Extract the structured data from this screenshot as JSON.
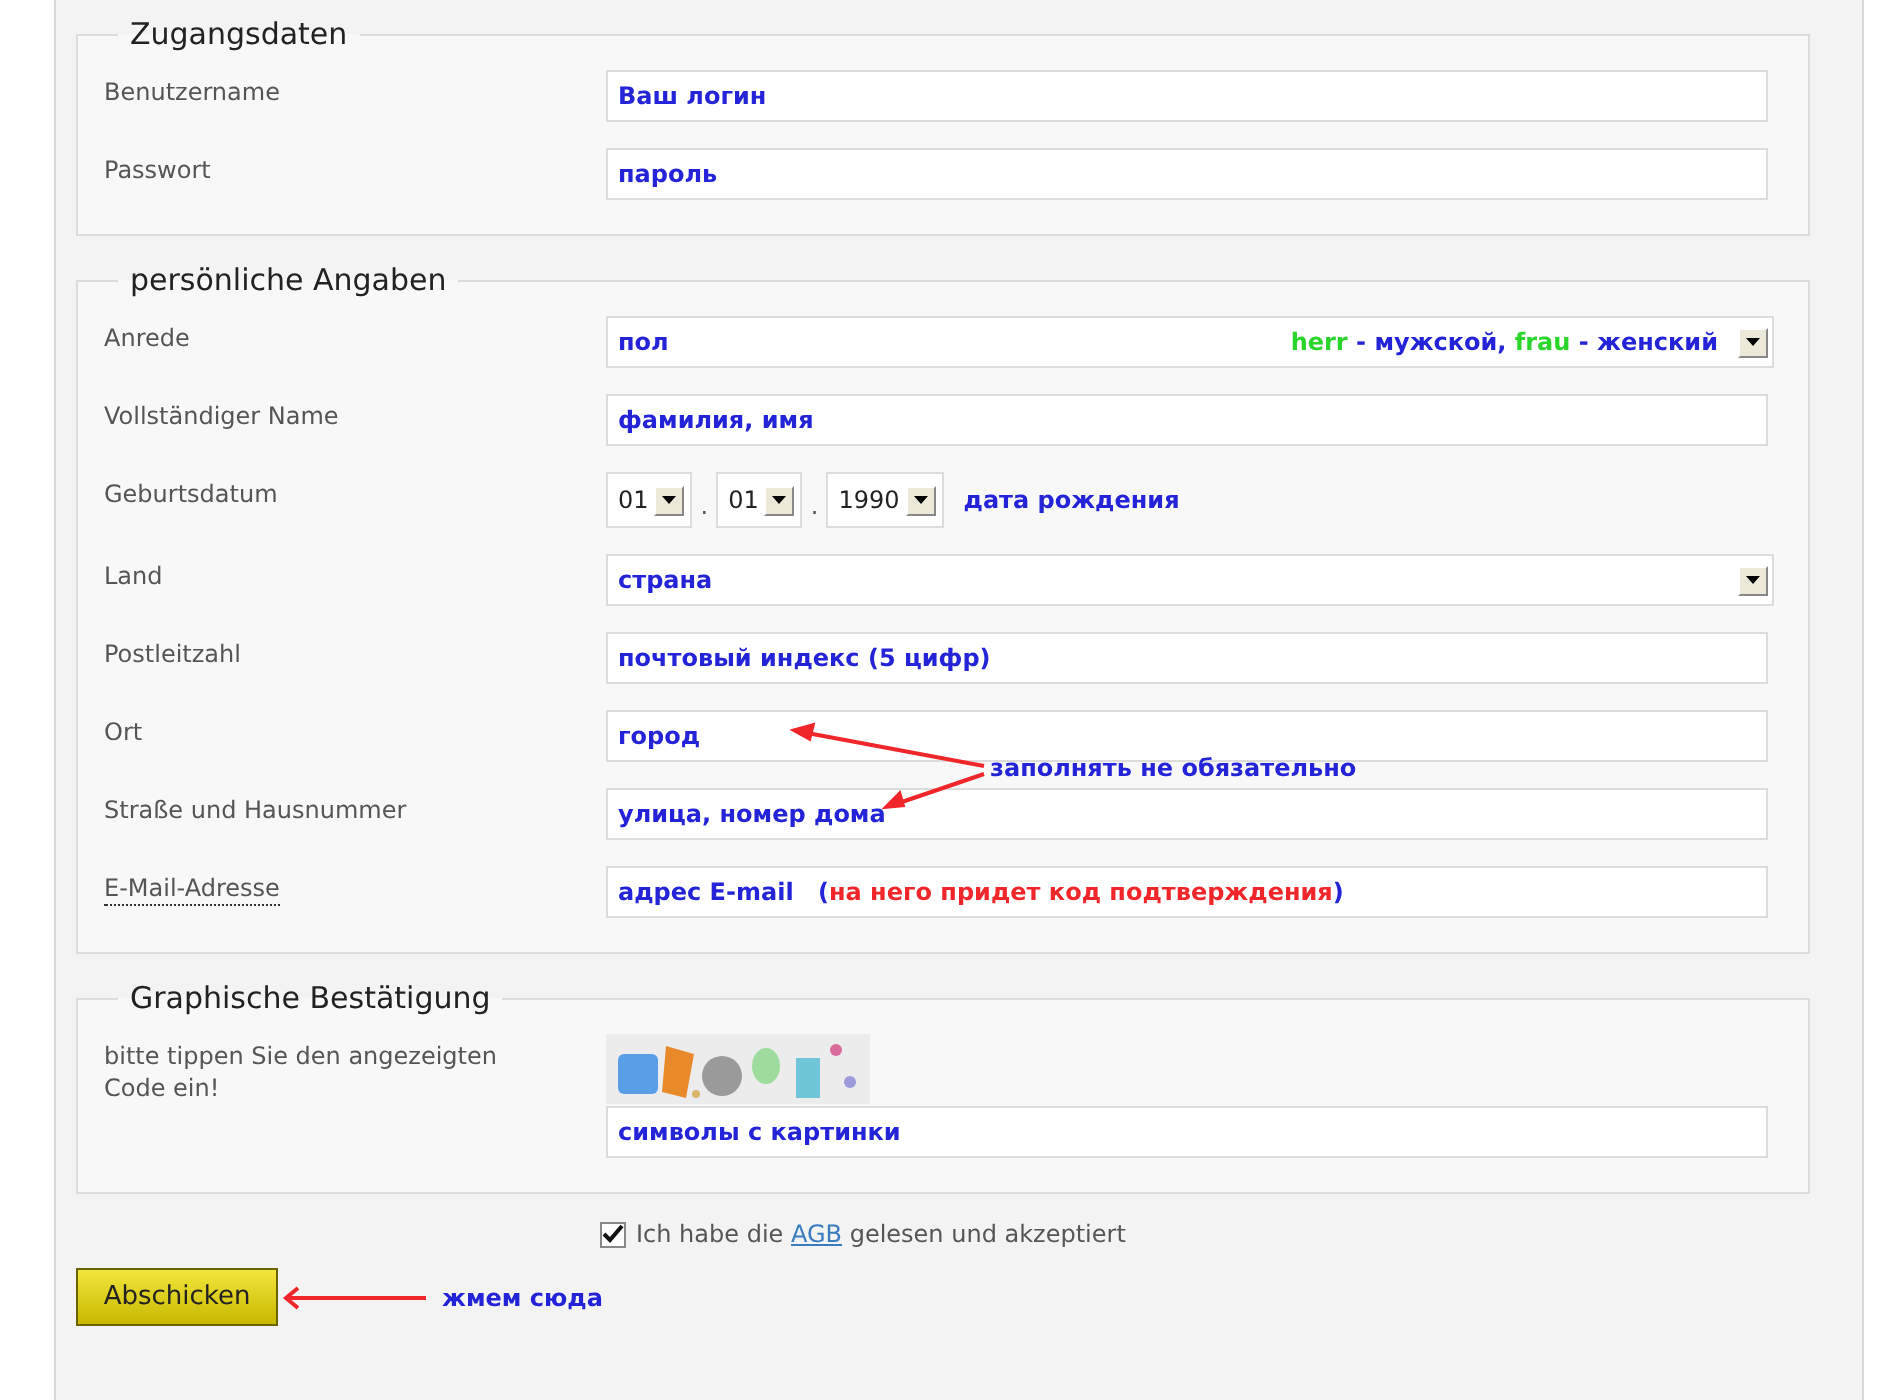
{
  "sections": [
    {
      "legend": "Zugangsdaten",
      "rows": [
        {
          "kind": "text",
          "label": "Benutzername",
          "value": "Ваш логин"
        },
        {
          "kind": "text",
          "label": "Passwort",
          "value": "пароль"
        }
      ]
    },
    {
      "legend": "persönliche Angaben",
      "rows": [
        {
          "kind": "select",
          "label": "Anrede",
          "value": "пол",
          "hint": [
            {
              "kind": "term",
              "text": "herr"
            },
            {
              "kind": "gloss",
              "text": "- мужской,"
            },
            {
              "kind": "term",
              "text": "frau"
            },
            {
              "kind": "gloss",
              "text": "- женский"
            }
          ]
        },
        {
          "kind": "text",
          "label": "Vollständiger Name",
          "value": "фамилия, имя"
        },
        {
          "kind": "date",
          "label": "Geburtsdatum",
          "parts": [
            {
              "kind": "select",
              "text": "01"
            },
            {
              "kind": "separator",
              "text": "."
            },
            {
              "kind": "select",
              "text": "01"
            },
            {
              "kind": "separator",
              "text": "."
            },
            {
              "kind": "select",
              "text": "1990"
            },
            {
              "kind": "note",
              "text": "дата рождения"
            }
          ]
        },
        {
          "kind": "select",
          "label": "Land",
          "value": "страна"
        },
        {
          "kind": "text",
          "label": "Postleitzahl",
          "value": "почтовый индекс (5 цифр)"
        },
        {
          "kind": "text",
          "label": "Ort",
          "value": "город"
        },
        {
          "kind": "text",
          "label": "Straße und Hausnummer",
          "value": "улица, номер дома"
        },
        {
          "kind": "text",
          "label": "E-Mail-Adresse",
          "abbr": true,
          "value": "адрес E-mail",
          "note": [
            {
              "kind": "gloss",
              "text": "("
            },
            {
              "kind": "warn",
              "text": "на него придет код подтверждения"
            },
            {
              "kind": "gloss",
              "text": ")"
            }
          ]
        }
      ],
      "callout": {
        "text": "заполнять не обязательно"
      }
    },
    {
      "legend": "Graphische Bestätigung",
      "rows": [
        {
          "kind": "captcha",
          "label": "bitte tippen Sie den angezeigten Code ein!",
          "value": "символы с картинки"
        }
      ]
    }
  ],
  "agreement": {
    "checked": true,
    "before": "Ich habe die",
    "link": "AGB",
    "after": "gelesen und akzeptiert"
  },
  "submit": {
    "label": "Abschicken",
    "note": "жмем сюда"
  }
}
